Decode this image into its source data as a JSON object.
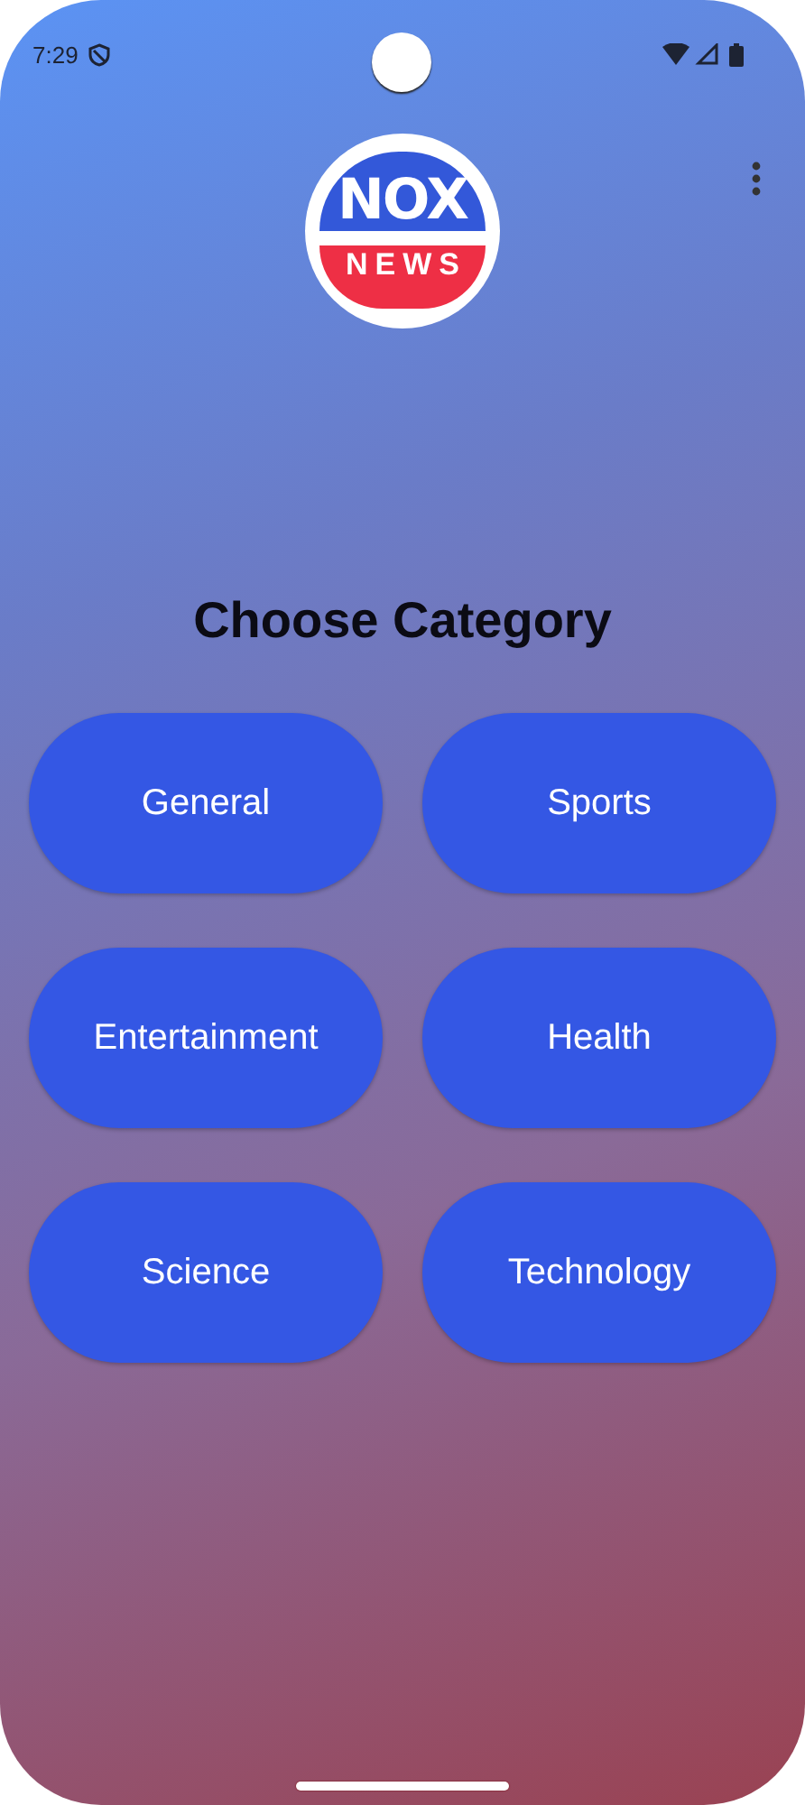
{
  "status_bar": {
    "time": "7:29"
  },
  "logo": {
    "top": "NOX",
    "bottom": "NEWS"
  },
  "title": "Choose Category",
  "categories": [
    {
      "label": "General"
    },
    {
      "label": "Sports"
    },
    {
      "label": "Entertainment"
    },
    {
      "label": "Health"
    },
    {
      "label": "Science"
    },
    {
      "label": "Technology"
    }
  ]
}
